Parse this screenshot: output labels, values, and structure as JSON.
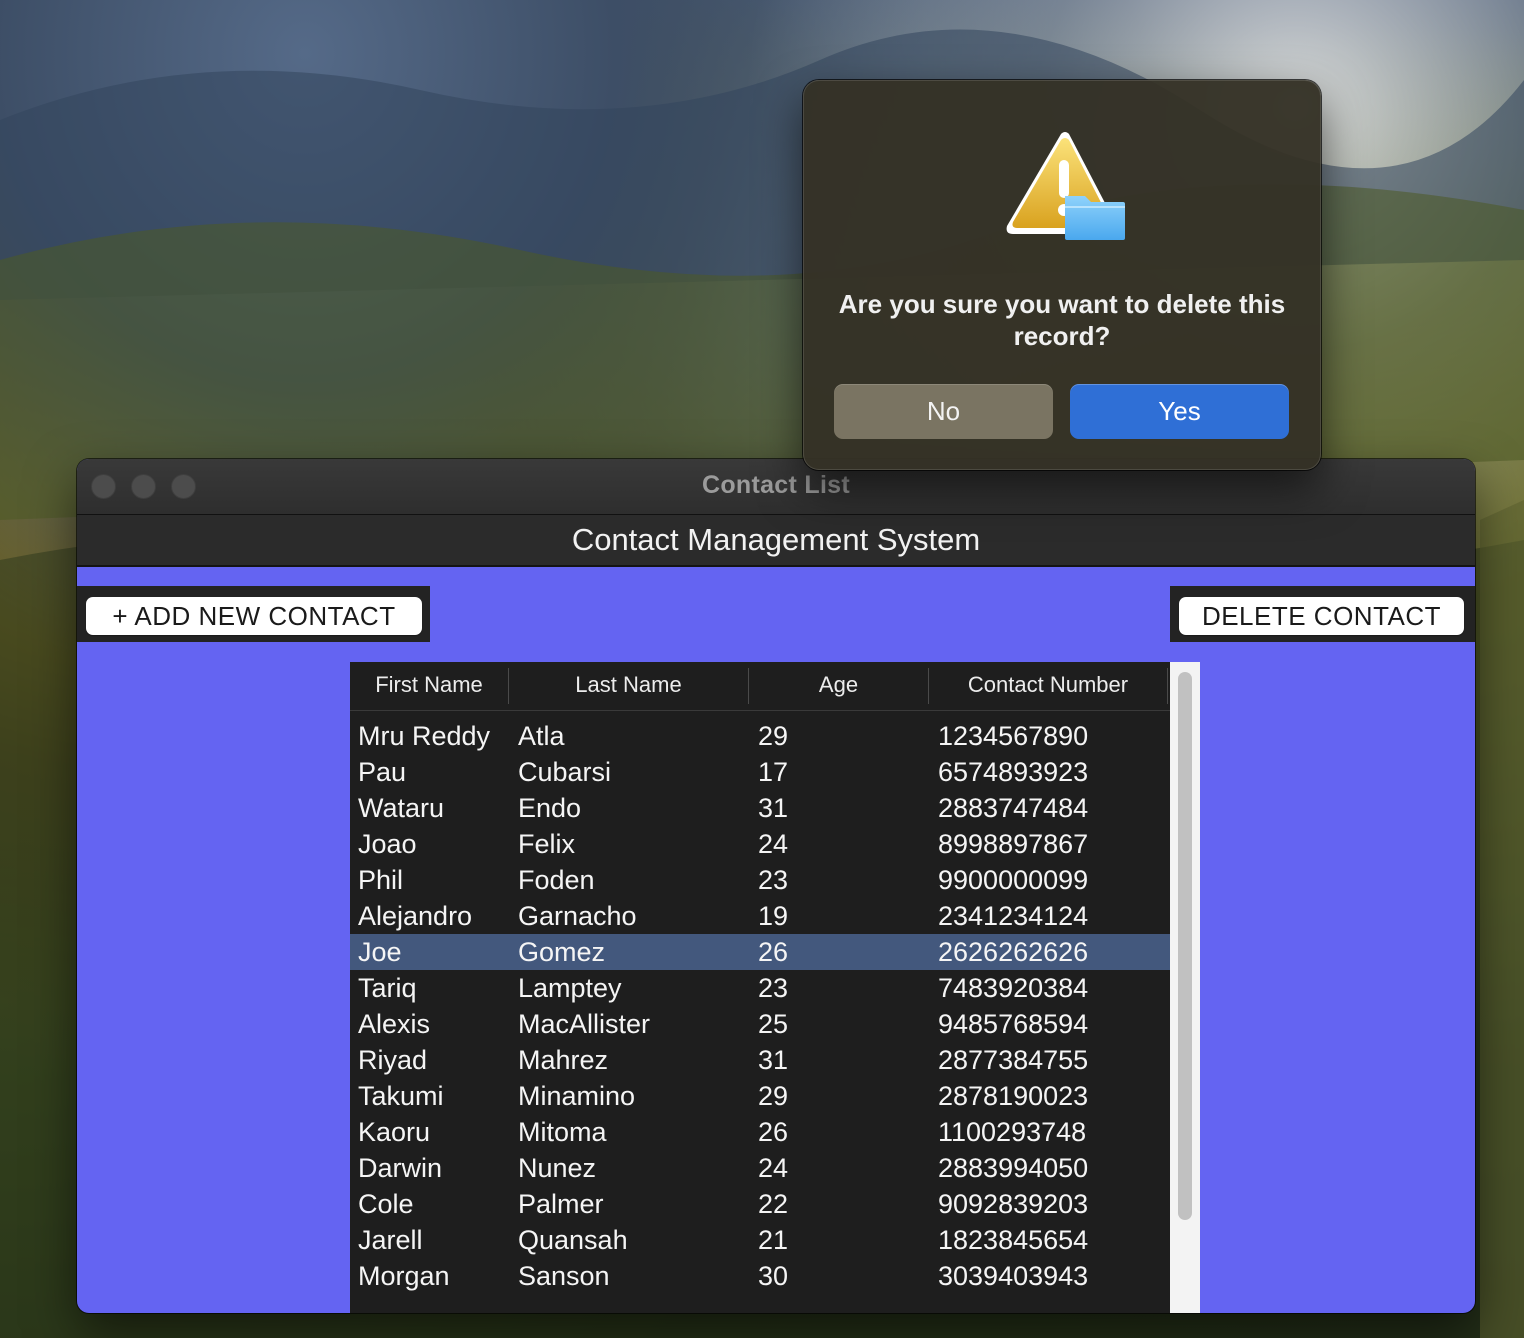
{
  "window": {
    "title": "Contact List"
  },
  "app": {
    "header": "Contact Management System",
    "add_button": "+ ADD NEW CONTACT",
    "delete_button": "DELETE CONTACT"
  },
  "table": {
    "columns": [
      "First Name",
      "Last Name",
      "Age",
      "Contact Number"
    ],
    "rows": [
      {
        "first": "Mru Reddy",
        "last": "Atla",
        "age": "29",
        "phone": "1234567890"
      },
      {
        "first": "Pau",
        "last": "Cubarsi",
        "age": "17",
        "phone": "6574893923"
      },
      {
        "first": "Wataru",
        "last": "Endo",
        "age": "31",
        "phone": "2883747484"
      },
      {
        "first": "Joao",
        "last": "Felix",
        "age": "24",
        "phone": "8998897867"
      },
      {
        "first": "Phil",
        "last": "Foden",
        "age": "23",
        "phone": "9900000099"
      },
      {
        "first": "Alejandro",
        "last": "Garnacho",
        "age": "19",
        "phone": "2341234124"
      },
      {
        "first": "Joe",
        "last": "Gomez",
        "age": "26",
        "phone": "2626262626"
      },
      {
        "first": "Tariq",
        "last": "Lamptey",
        "age": "23",
        "phone": "7483920384"
      },
      {
        "first": "Alexis",
        "last": "MacAllister",
        "age": "25",
        "phone": "9485768594"
      },
      {
        "first": "Riyad",
        "last": "Mahrez",
        "age": "31",
        "phone": "2877384755"
      },
      {
        "first": "Takumi",
        "last": "Minamino",
        "age": "29",
        "phone": "2878190023"
      },
      {
        "first": "Kaoru",
        "last": "Mitoma",
        "age": "26",
        "phone": "1100293748"
      },
      {
        "first": "Darwin",
        "last": "Nunez",
        "age": "24",
        "phone": "2883994050"
      },
      {
        "first": "Cole",
        "last": "Palmer",
        "age": "22",
        "phone": "9092839203"
      },
      {
        "first": "Jarell",
        "last": "Quansah",
        "age": "21",
        "phone": "1823845654"
      },
      {
        "first": "Morgan",
        "last": "Sanson",
        "age": "30",
        "phone": "3039403943"
      }
    ],
    "selected_index": 6
  },
  "dialog": {
    "message": "Are you sure you want to delete this record?",
    "no_label": "No",
    "yes_label": "Yes",
    "icon": "warning-icon"
  },
  "colors": {
    "window_bg": "#6464f2",
    "selection": "#43587d",
    "accent_button": "#2f6fd6"
  }
}
